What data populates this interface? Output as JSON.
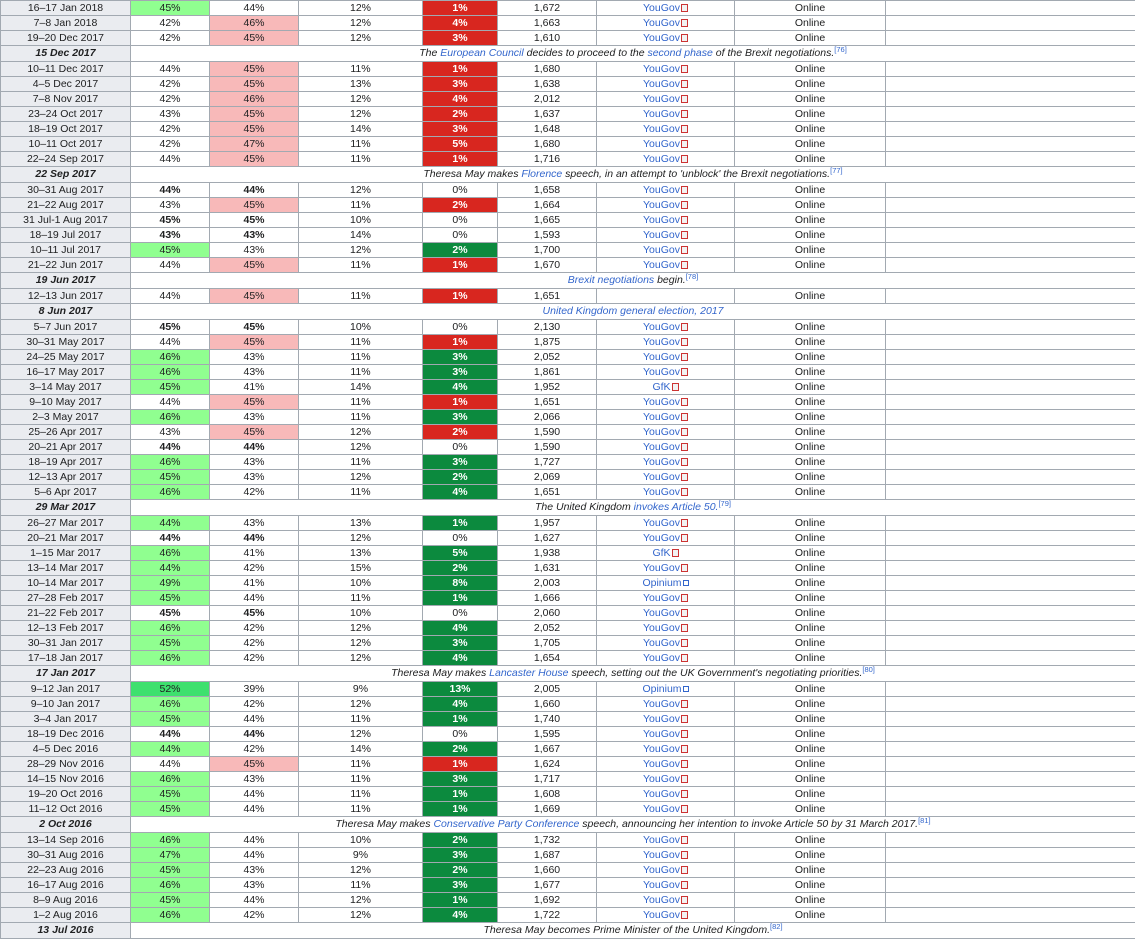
{
  "rows": [
    {
      "type": "poll",
      "date": "16–17 Jan 2018",
      "leave": "45%",
      "remain": "44%",
      "dk": "12%",
      "lead": "1%",
      "sample": "1,672",
      "pollster": "YouGov",
      "method": "Online",
      "lc": "l",
      "ls": "neg"
    },
    {
      "type": "poll",
      "date": "7–8 Jan 2018",
      "leave": "42%",
      "remain": "46%",
      "dk": "12%",
      "lead": "4%",
      "sample": "1,663",
      "pollster": "YouGov",
      "method": "Online",
      "lc": "r",
      "ls": "neg"
    },
    {
      "type": "poll",
      "date": "19–20 Dec 2017",
      "leave": "42%",
      "remain": "45%",
      "dk": "12%",
      "lead": "3%",
      "sample": "1,610",
      "pollster": "YouGov",
      "method": "Online",
      "lc": "r",
      "ls": "neg"
    },
    {
      "type": "event",
      "date": "15 Dec 2017",
      "parts": [
        {
          "t": "The "
        },
        {
          "t": "European Council",
          "l": 1
        },
        {
          "t": " decides to proceed to the "
        },
        {
          "t": "second phase",
          "l": 1
        },
        {
          "t": " of the Brexit negotiations."
        }
      ],
      "ref": "[76]"
    },
    {
      "type": "poll",
      "date": "10–11 Dec 2017",
      "leave": "44%",
      "remain": "45%",
      "dk": "11%",
      "lead": "1%",
      "sample": "1,680",
      "pollster": "YouGov",
      "method": "Online",
      "lc": "r",
      "ls": "neg"
    },
    {
      "type": "poll",
      "date": "4–5 Dec 2017",
      "leave": "42%",
      "remain": "45%",
      "dk": "13%",
      "lead": "3%",
      "sample": "1,638",
      "pollster": "YouGov",
      "method": "Online",
      "lc": "r",
      "ls": "neg"
    },
    {
      "type": "poll",
      "date": "7–8 Nov 2017",
      "leave": "42%",
      "remain": "46%",
      "dk": "12%",
      "lead": "4%",
      "sample": "2,012",
      "pollster": "YouGov",
      "method": "Online",
      "lc": "r",
      "ls": "neg"
    },
    {
      "type": "poll",
      "date": "23–24 Oct 2017",
      "leave": "43%",
      "remain": "45%",
      "dk": "12%",
      "lead": "2%",
      "sample": "1,637",
      "pollster": "YouGov",
      "method": "Online",
      "lc": "r",
      "ls": "neg"
    },
    {
      "type": "poll",
      "date": "18–19 Oct 2017",
      "leave": "42%",
      "remain": "45%",
      "dk": "14%",
      "lead": "3%",
      "sample": "1,648",
      "pollster": "YouGov",
      "method": "Online",
      "lc": "r",
      "ls": "neg"
    },
    {
      "type": "poll",
      "date": "10–11 Oct 2017",
      "leave": "42%",
      "remain": "47%",
      "dk": "11%",
      "lead": "5%",
      "sample": "1,680",
      "pollster": "YouGov",
      "method": "Online",
      "lc": "r",
      "ls": "neg"
    },
    {
      "type": "poll",
      "date": "22–24 Sep 2017",
      "leave": "44%",
      "remain": "45%",
      "dk": "11%",
      "lead": "1%",
      "sample": "1,716",
      "pollster": "YouGov",
      "method": "Online",
      "lc": "r",
      "ls": "neg"
    },
    {
      "type": "event",
      "date": "22 Sep 2017",
      "parts": [
        {
          "t": "Theresa May makes "
        },
        {
          "t": "Florence",
          "l": 1
        },
        {
          "t": " speech, in an attempt to 'unblock' the Brexit negotiations."
        }
      ],
      "ref": "[77]"
    },
    {
      "type": "poll",
      "date": "30–31 Aug 2017",
      "leave": "44%",
      "remain": "44%",
      "dk": "12%",
      "lead": "0%",
      "sample": "1,658",
      "pollster": "YouGov",
      "method": "Online",
      "lc": "t",
      "ls": "zero"
    },
    {
      "type": "poll",
      "date": "21–22 Aug 2017",
      "leave": "43%",
      "remain": "45%",
      "dk": "11%",
      "lead": "2%",
      "sample": "1,664",
      "pollster": "YouGov",
      "method": "Online",
      "lc": "r",
      "ls": "neg"
    },
    {
      "type": "poll",
      "date": "31 Jul-1 Aug 2017",
      "leave": "45%",
      "remain": "45%",
      "dk": "10%",
      "lead": "0%",
      "sample": "1,665",
      "pollster": "YouGov",
      "method": "Online",
      "lc": "t",
      "ls": "zero"
    },
    {
      "type": "poll",
      "date": "18–19 Jul 2017",
      "leave": "43%",
      "remain": "43%",
      "dk": "14%",
      "lead": "0%",
      "sample": "1,593",
      "pollster": "YouGov",
      "method": "Online",
      "lc": "t",
      "ls": "zero"
    },
    {
      "type": "poll",
      "date": "10–11 Jul 2017",
      "leave": "45%",
      "remain": "43%",
      "dk": "12%",
      "lead": "2%",
      "sample": "1,700",
      "pollster": "YouGov",
      "method": "Online",
      "lc": "l",
      "ls": "pos"
    },
    {
      "type": "poll",
      "date": "21–22 Jun 2017",
      "leave": "44%",
      "remain": "45%",
      "dk": "11%",
      "lead": "1%",
      "sample": "1,670",
      "pollster": "YouGov",
      "method": "Online",
      "lc": "r",
      "ls": "neg"
    },
    {
      "type": "event",
      "date": "19 Jun 2017",
      "parts": [
        {
          "t": "Brexit negotiations",
          "l": 1
        },
        {
          "t": " begin."
        }
      ],
      "ref": "[78]"
    },
    {
      "type": "poll",
      "date": "12–13 Jun 2017",
      "leave": "44%",
      "remain": "45%",
      "dk": "11%",
      "lead": "1%",
      "sample": "1,651",
      "pollster": "",
      "method": "Online",
      "lc": "r",
      "ls": "neg"
    },
    {
      "type": "event",
      "date": "8 Jun 2017",
      "parts": [
        {
          "t": "United Kingdom general election, 2017",
          "l": 1
        }
      ],
      "ref": ""
    },
    {
      "type": "poll",
      "date": "5–7 Jun 2017",
      "leave": "45%",
      "remain": "45%",
      "dk": "10%",
      "lead": "0%",
      "sample": "2,130",
      "pollster": "YouGov",
      "method": "Online",
      "lc": "t",
      "ls": "zero"
    },
    {
      "type": "poll",
      "date": "30–31 May 2017",
      "leave": "44%",
      "remain": "45%",
      "dk": "11%",
      "lead": "1%",
      "sample": "1,875",
      "pollster": "YouGov",
      "method": "Online",
      "lc": "r",
      "ls": "neg"
    },
    {
      "type": "poll",
      "date": "24–25 May 2017",
      "leave": "46%",
      "remain": "43%",
      "dk": "11%",
      "lead": "3%",
      "sample": "2,052",
      "pollster": "YouGov",
      "method": "Online",
      "lc": "l",
      "ls": "pos"
    },
    {
      "type": "poll",
      "date": "16–17 May 2017",
      "leave": "46%",
      "remain": "43%",
      "dk": "11%",
      "lead": "3%",
      "sample": "1,861",
      "pollster": "YouGov",
      "method": "Online",
      "lc": "l",
      "ls": "pos"
    },
    {
      "type": "poll",
      "date": "3–14 May 2017",
      "leave": "45%",
      "remain": "41%",
      "dk": "14%",
      "lead": "4%",
      "sample": "1,952",
      "pollster": "GfK",
      "method": "Online",
      "lc": "l",
      "ls": "pos"
    },
    {
      "type": "poll",
      "date": "9–10 May 2017",
      "leave": "44%",
      "remain": "45%",
      "dk": "11%",
      "lead": "1%",
      "sample": "1,651",
      "pollster": "YouGov",
      "method": "Online",
      "lc": "r",
      "ls": "neg"
    },
    {
      "type": "poll",
      "date": "2–3 May 2017",
      "leave": "46%",
      "remain": "43%",
      "dk": "11%",
      "lead": "3%",
      "sample": "2,066",
      "pollster": "YouGov",
      "method": "Online",
      "lc": "l",
      "ls": "pos"
    },
    {
      "type": "poll",
      "date": "25–26 Apr 2017",
      "leave": "43%",
      "remain": "45%",
      "dk": "12%",
      "lead": "2%",
      "sample": "1,590",
      "pollster": "YouGov",
      "method": "Online",
      "lc": "r",
      "ls": "neg"
    },
    {
      "type": "poll",
      "date": "20–21 Apr 2017",
      "leave": "44%",
      "remain": "44%",
      "dk": "12%",
      "lead": "0%",
      "sample": "1,590",
      "pollster": "YouGov",
      "method": "Online",
      "lc": "t",
      "ls": "zero"
    },
    {
      "type": "poll",
      "date": "18–19 Apr 2017",
      "leave": "46%",
      "remain": "43%",
      "dk": "11%",
      "lead": "3%",
      "sample": "1,727",
      "pollster": "YouGov",
      "method": "Online",
      "lc": "l",
      "ls": "pos"
    },
    {
      "type": "poll",
      "date": "12–13 Apr 2017",
      "leave": "45%",
      "remain": "43%",
      "dk": "12%",
      "lead": "2%",
      "sample": "2,069",
      "pollster": "YouGov",
      "method": "Online",
      "lc": "l",
      "ls": "pos"
    },
    {
      "type": "poll",
      "date": "5–6 Apr 2017",
      "leave": "46%",
      "remain": "42%",
      "dk": "11%",
      "lead": "4%",
      "sample": "1,651",
      "pollster": "YouGov",
      "method": "Online",
      "lc": "l",
      "ls": "pos"
    },
    {
      "type": "event",
      "date": "29 Mar 2017",
      "parts": [
        {
          "t": "The United Kingdom "
        },
        {
          "t": "invokes Article 50.",
          "l": 1
        }
      ],
      "ref": "[79]"
    },
    {
      "type": "poll",
      "date": "26–27 Mar 2017",
      "leave": "44%",
      "remain": "43%",
      "dk": "13%",
      "lead": "1%",
      "sample": "1,957",
      "pollster": "YouGov",
      "method": "Online",
      "lc": "l",
      "ls": "pos"
    },
    {
      "type": "poll",
      "date": "20–21 Mar 2017",
      "leave": "44%",
      "remain": "44%",
      "dk": "12%",
      "lead": "0%",
      "sample": "1,627",
      "pollster": "YouGov",
      "method": "Online",
      "lc": "t",
      "ls": "zero"
    },
    {
      "type": "poll",
      "date": "1–15 Mar 2017",
      "leave": "46%",
      "remain": "41%",
      "dk": "13%",
      "lead": "5%",
      "sample": "1,938",
      "pollster": "GfK",
      "method": "Online",
      "lc": "l",
      "ls": "pos"
    },
    {
      "type": "poll",
      "date": "13–14 Mar 2017",
      "leave": "44%",
      "remain": "42%",
      "dk": "15%",
      "lead": "2%",
      "sample": "1,631",
      "pollster": "YouGov",
      "method": "Online",
      "lc": "l",
      "ls": "pos"
    },
    {
      "type": "poll",
      "date": "10–14 Mar 2017",
      "leave": "49%",
      "remain": "41%",
      "dk": "10%",
      "lead": "8%",
      "sample": "2,003",
      "pollster": "Opinium",
      "method": "Online",
      "lc": "l",
      "ls": "pos"
    },
    {
      "type": "poll",
      "date": "27–28 Feb 2017",
      "leave": "45%",
      "remain": "44%",
      "dk": "11%",
      "lead": "1%",
      "sample": "1,666",
      "pollster": "YouGov",
      "method": "Online",
      "lc": "l",
      "ls": "pos"
    },
    {
      "type": "poll",
      "date": "21–22 Feb 2017",
      "leave": "45%",
      "remain": "45%",
      "dk": "10%",
      "lead": "0%",
      "sample": "2,060",
      "pollster": "YouGov",
      "method": "Online",
      "lc": "t",
      "ls": "zero"
    },
    {
      "type": "poll",
      "date": "12–13 Feb 2017",
      "leave": "46%",
      "remain": "42%",
      "dk": "12%",
      "lead": "4%",
      "sample": "2,052",
      "pollster": "YouGov",
      "method": "Online",
      "lc": "l",
      "ls": "pos"
    },
    {
      "type": "poll",
      "date": "30–31 Jan 2017",
      "leave": "45%",
      "remain": "42%",
      "dk": "12%",
      "lead": "3%",
      "sample": "1,705",
      "pollster": "YouGov",
      "method": "Online",
      "lc": "l",
      "ls": "pos"
    },
    {
      "type": "poll",
      "date": "17–18 Jan 2017",
      "leave": "46%",
      "remain": "42%",
      "dk": "12%",
      "lead": "4%",
      "sample": "1,654",
      "pollster": "YouGov",
      "method": "Online",
      "lc": "l",
      "ls": "pos"
    },
    {
      "type": "event",
      "date": "17 Jan 2017",
      "parts": [
        {
          "t": "Theresa May makes "
        },
        {
          "t": "Lancaster House",
          "l": 1
        },
        {
          "t": " speech, setting out the UK Government's negotiating priorities."
        }
      ],
      "ref": "[80]"
    },
    {
      "type": "poll",
      "date": "9–12 Jan 2017",
      "leave": "52%",
      "remain": "39%",
      "dk": "9%",
      "lead": "13%",
      "sample": "2,005",
      "pollster": "Opinium",
      "method": "Online",
      "lc": "s",
      "ls": "pos"
    },
    {
      "type": "poll",
      "date": "9–10 Jan 2017",
      "leave": "46%",
      "remain": "42%",
      "dk": "12%",
      "lead": "4%",
      "sample": "1,660",
      "pollster": "YouGov",
      "method": "Online",
      "lc": "l",
      "ls": "pos"
    },
    {
      "type": "poll",
      "date": "3–4 Jan 2017",
      "leave": "45%",
      "remain": "44%",
      "dk": "11%",
      "lead": "1%",
      "sample": "1,740",
      "pollster": "YouGov",
      "method": "Online",
      "lc": "l",
      "ls": "pos"
    },
    {
      "type": "poll",
      "date": "18–19 Dec 2016",
      "leave": "44%",
      "remain": "44%",
      "dk": "12%",
      "lead": "0%",
      "sample": "1,595",
      "pollster": "YouGov",
      "method": "Online",
      "lc": "t",
      "ls": "zero"
    },
    {
      "type": "poll",
      "date": "4–5 Dec 2016",
      "leave": "44%",
      "remain": "42%",
      "dk": "14%",
      "lead": "2%",
      "sample": "1,667",
      "pollster": "YouGov",
      "method": "Online",
      "lc": "l",
      "ls": "pos"
    },
    {
      "type": "poll",
      "date": "28–29 Nov 2016",
      "leave": "44%",
      "remain": "45%",
      "dk": "11%",
      "lead": "1%",
      "sample": "1,624",
      "pollster": "YouGov",
      "method": "Online",
      "lc": "r",
      "ls": "neg"
    },
    {
      "type": "poll",
      "date": "14–15 Nov 2016",
      "leave": "46%",
      "remain": "43%",
      "dk": "11%",
      "lead": "3%",
      "sample": "1,717",
      "pollster": "YouGov",
      "method": "Online",
      "lc": "l",
      "ls": "pos"
    },
    {
      "type": "poll",
      "date": "19–20 Oct 2016",
      "leave": "45%",
      "remain": "44%",
      "dk": "11%",
      "lead": "1%",
      "sample": "1,608",
      "pollster": "YouGov",
      "method": "Online",
      "lc": "l",
      "ls": "pos"
    },
    {
      "type": "poll",
      "date": "11–12 Oct 2016",
      "leave": "45%",
      "remain": "44%",
      "dk": "11%",
      "lead": "1%",
      "sample": "1,669",
      "pollster": "YouGov",
      "method": "Online",
      "lc": "l",
      "ls": "pos"
    },
    {
      "type": "event",
      "date": "2 Oct 2016",
      "parts": [
        {
          "t": "Theresa May makes "
        },
        {
          "t": "Conservative Party Conference",
          "l": 1
        },
        {
          "t": " speech, announcing her intention to invoke Article 50 by 31 March 2017."
        }
      ],
      "ref": "[81]"
    },
    {
      "type": "poll",
      "date": "13–14 Sep 2016",
      "leave": "46%",
      "remain": "44%",
      "dk": "10%",
      "lead": "2%",
      "sample": "1,732",
      "pollster": "YouGov",
      "method": "Online",
      "lc": "l",
      "ls": "pos"
    },
    {
      "type": "poll",
      "date": "30–31 Aug 2016",
      "leave": "47%",
      "remain": "44%",
      "dk": "9%",
      "lead": "3%",
      "sample": "1,687",
      "pollster": "YouGov",
      "method": "Online",
      "lc": "l",
      "ls": "pos"
    },
    {
      "type": "poll",
      "date": "22–23 Aug 2016",
      "leave": "45%",
      "remain": "43%",
      "dk": "12%",
      "lead": "2%",
      "sample": "1,660",
      "pollster": "YouGov",
      "method": "Online",
      "lc": "l",
      "ls": "pos"
    },
    {
      "type": "poll",
      "date": "16–17 Aug 2016",
      "leave": "46%",
      "remain": "43%",
      "dk": "11%",
      "lead": "3%",
      "sample": "1,677",
      "pollster": "YouGov",
      "method": "Online",
      "lc": "l",
      "ls": "pos"
    },
    {
      "type": "poll",
      "date": "8–9 Aug 2016",
      "leave": "45%",
      "remain": "44%",
      "dk": "12%",
      "lead": "1%",
      "sample": "1,692",
      "pollster": "YouGov",
      "method": "Online",
      "lc": "l",
      "ls": "pos"
    },
    {
      "type": "poll",
      "date": "1–2 Aug 2016",
      "leave": "46%",
      "remain": "42%",
      "dk": "12%",
      "lead": "4%",
      "sample": "1,722",
      "pollster": "YouGov",
      "method": "Online",
      "lc": "l",
      "ls": "pos"
    },
    {
      "type": "event",
      "date": "13 Jul 2016",
      "parts": [
        {
          "t": "Theresa May becomes Prime Minister of the United Kingdom."
        }
      ],
      "ref": "[82]"
    }
  ],
  "colors": {
    "leave_lead": "#90ff90",
    "leave_lead_strong": "#3ee06e",
    "remain_lead": "#f8b9b9",
    "negative_lead": "#d8261f",
    "positive_lead": "#0c8a3e",
    "date_cell": "#eaecf0",
    "link": "#3366cc",
    "border": "#a2a9b1"
  },
  "icons": {
    "YouGov": "pdf-icon",
    "GfK": "pdf-icon",
    "Opinium": "external-link-icon"
  }
}
